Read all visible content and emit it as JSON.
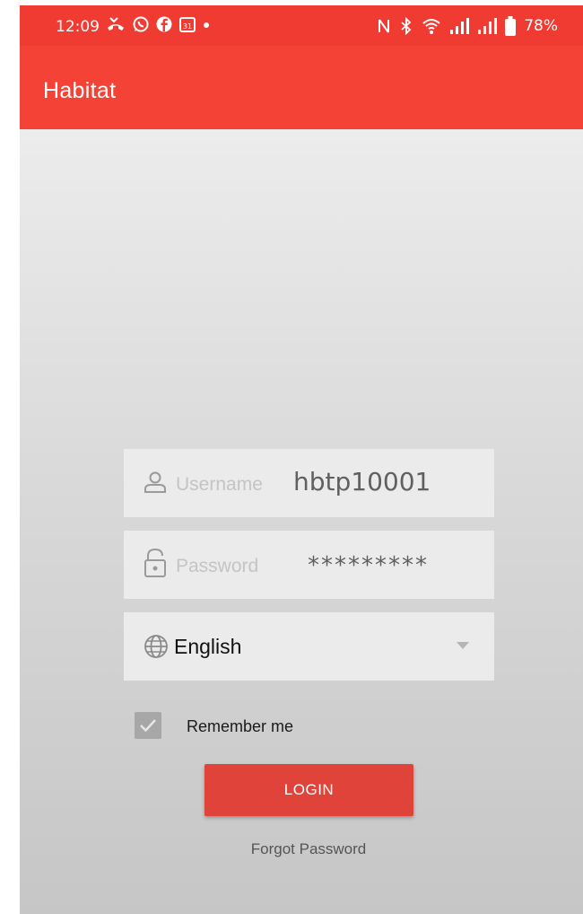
{
  "status_bar": {
    "time": "12:09",
    "battery_percent": "78%",
    "notification_icons": [
      "missed-call-icon",
      "whatsapp-icon",
      "facebook-icon",
      "calendar-icon",
      "dot-icon"
    ],
    "calendar_date": "31",
    "system_icons": [
      "nfc-icon",
      "bluetooth-icon",
      "wifi-icon",
      "signal-icon",
      "signal-icon",
      "battery-icon"
    ]
  },
  "app_bar": {
    "title": "Habitat",
    "color": "#f44336"
  },
  "login_form": {
    "username": {
      "placeholder": "Username",
      "value": "hbtp10001"
    },
    "password": {
      "placeholder": "Password",
      "value": "*********"
    },
    "language": {
      "selected": "English"
    },
    "remember_me": {
      "label": "Remember me",
      "checked": true
    },
    "login_button": {
      "label": "LOGIN",
      "color": "#e0433a"
    },
    "forgot_password": "Forgot Password"
  }
}
